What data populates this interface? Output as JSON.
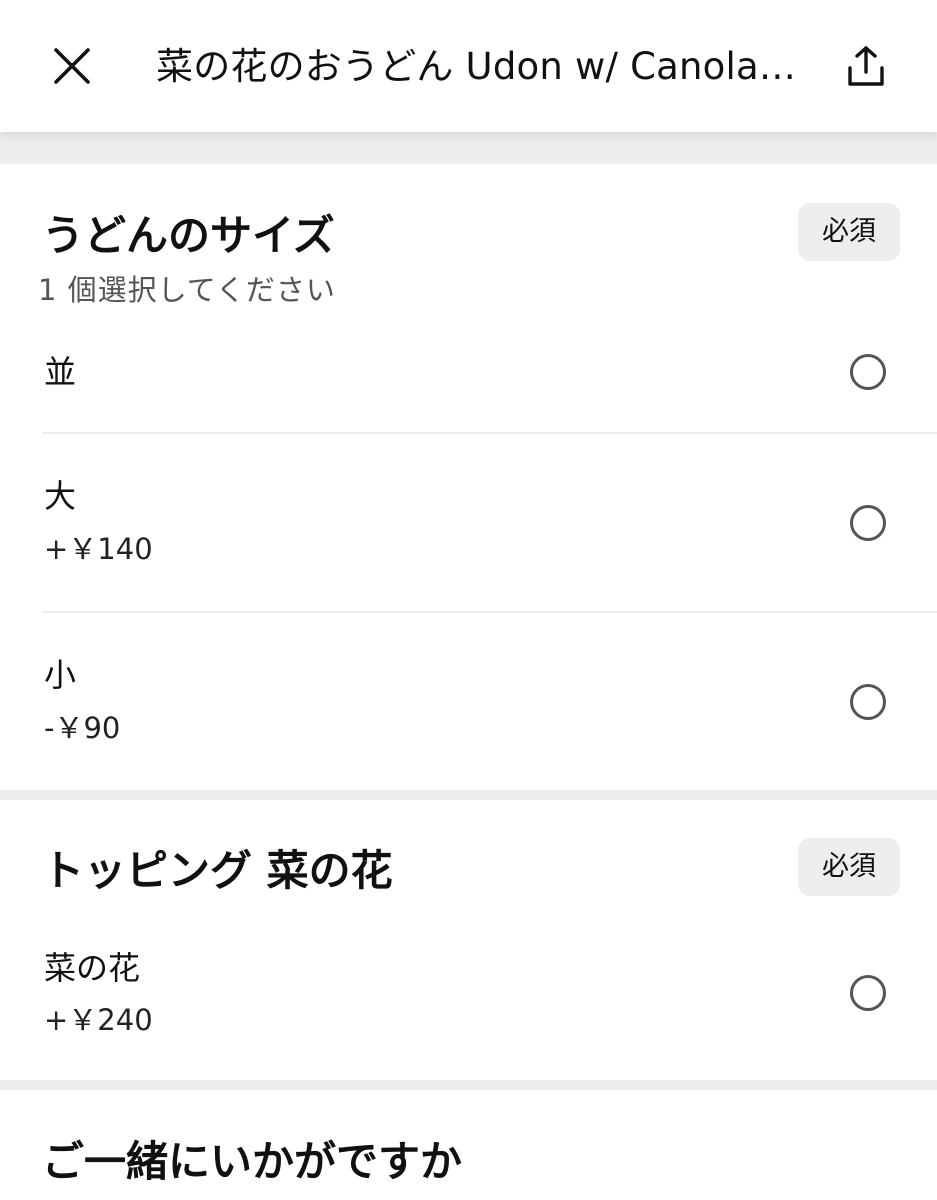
{
  "header": {
    "title": "菜の花のおうどん Udon w/ Canola Flowers",
    "close_icon": "close-icon",
    "share_icon": "share-icon"
  },
  "sections": [
    {
      "title": "うどんのサイズ",
      "subtitle": "1 個選択してください",
      "badge": "必須",
      "options": [
        {
          "label": "並",
          "price": ""
        },
        {
          "label": "大",
          "price": "+￥140"
        },
        {
          "label": "小",
          "price": "-￥90"
        }
      ]
    },
    {
      "title": "トッピング 菜の花",
      "badge": "必須",
      "options": [
        {
          "label": "菜の花",
          "price": "+￥240"
        }
      ]
    },
    {
      "title": "ご一緒にいかがですか"
    }
  ]
}
